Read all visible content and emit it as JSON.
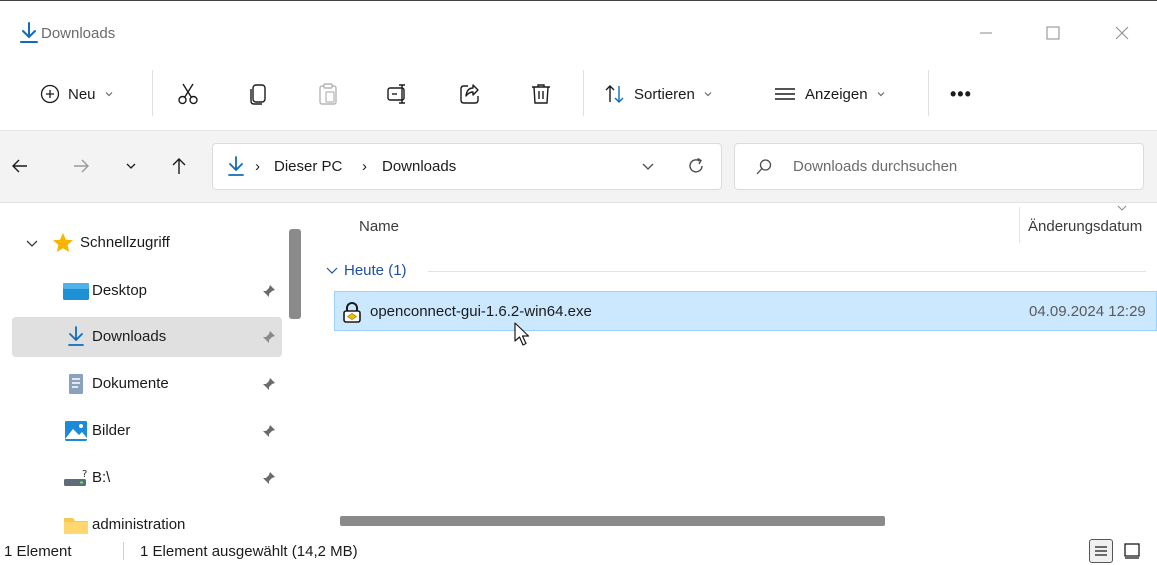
{
  "window": {
    "title": "Downloads",
    "controls": [
      "minimize-icon",
      "maximize-icon",
      "close-icon"
    ]
  },
  "toolbar": {
    "new_label": "Neu",
    "sort_label": "Sortieren",
    "view_label": "Anzeigen",
    "more_label": "•••",
    "icons": [
      "cut-icon",
      "copy-icon",
      "paste-icon",
      "rename-icon",
      "share-icon",
      "delete-icon"
    ]
  },
  "address": {
    "crumbs": [
      "Dieser PC",
      "Downloads"
    ],
    "search_placeholder": "Downloads durchsuchen"
  },
  "sidebar": {
    "quick_access": "Schnellzugriff",
    "items": [
      {
        "label": "Desktop",
        "icon": "desktop-folder-icon",
        "pinned": true
      },
      {
        "label": "Downloads",
        "icon": "download-icon",
        "pinned": true,
        "selected": true
      },
      {
        "label": "Dokumente",
        "icon": "documents-icon",
        "pinned": true
      },
      {
        "label": "Bilder",
        "icon": "pictures-icon",
        "pinned": true
      },
      {
        "label": "B:\\",
        "icon": "network-drive-icon",
        "pinned": true
      },
      {
        "label": "administration",
        "icon": "folder-icon",
        "pinned": false
      }
    ]
  },
  "content": {
    "columns": {
      "name": "Name",
      "date": "Änderungsdatum"
    },
    "group": {
      "label": "Heute (1)"
    },
    "files": [
      {
        "name": "openconnect-gui-1.6.2-win64.exe",
        "date": "04.09.2024 12:29",
        "icon": "installer-icon",
        "selected": true
      }
    ]
  },
  "status": {
    "count": "1 Element",
    "selection": "1 Element ausgewählt (14,2 MB)"
  },
  "colors": {
    "accent": "#0f6cbd",
    "selection": "#cce8ff",
    "group_header": "#1f4fa6"
  }
}
